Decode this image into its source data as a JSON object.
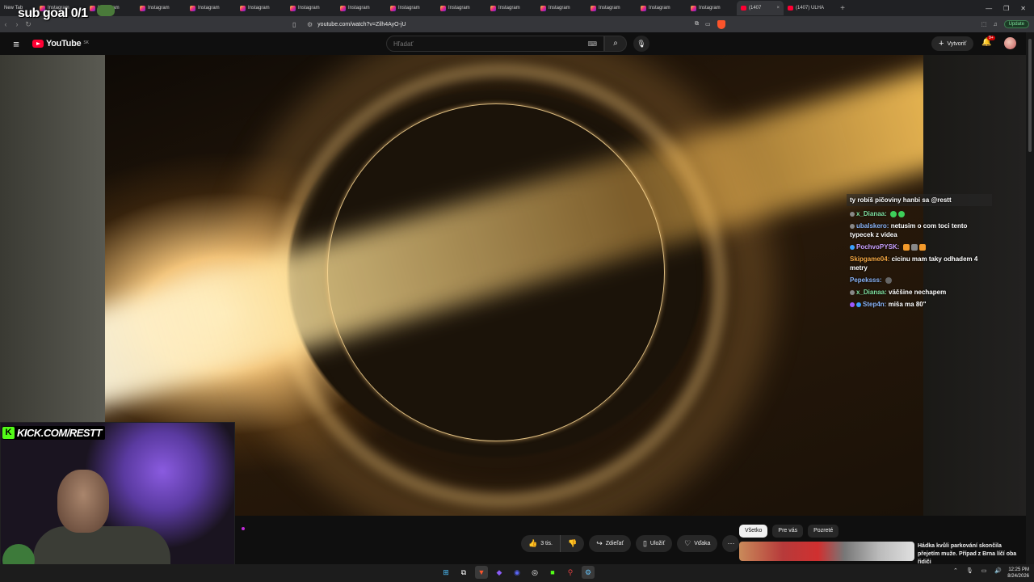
{
  "tabs": {
    "newtab_label": "New Tab",
    "items": [
      "Instagram",
      "Instagram",
      "Instagram",
      "Instagram",
      "Instagram",
      "Instagram",
      "Instagram",
      "Instagram",
      "Instagram",
      "Instagram",
      "Instagram",
      "Instagram",
      "Instagram",
      "Instagram"
    ],
    "active_label": "(1407",
    "next_label": "(1407) ULHA",
    "close": "×",
    "plus": "+"
  },
  "addressbar": {
    "url": "youtube.com/watch?v=Zilh4AyO-jU",
    "update_label": "Update"
  },
  "youtube": {
    "logo_text": "YouTube",
    "country": "SK",
    "search_placeholder": "Hľadať",
    "create_label": "Vytvoriť",
    "notif_badge": "9+"
  },
  "overlay": {
    "sub_goal": "sub goal 0/1",
    "kick_text": "KICK.COM/RESTT",
    "kick_k": "K"
  },
  "chat": [
    {
      "user": "",
      "message": "ty robíš pičoviny hanbi sa @restt",
      "user_color": "#ffffff"
    },
    {
      "user": "x_Dianaa:",
      "message": "",
      "user_color": "#7fe0a0"
    },
    {
      "user": "ubalskero:",
      "message": "netusim o com toci tento typecek z videa",
      "user_color": "#8ab4f8"
    },
    {
      "user": "PochvoPYSK:",
      "message": "",
      "user_color": "#c9a0ff"
    },
    {
      "user": "Skipgame04:",
      "message": "cicinu mam taky odhadem 4 metry",
      "user_color": "#f5a742"
    },
    {
      "user": "Pepeksss:",
      "message": "",
      "user_color": "#8ab4f8"
    },
    {
      "user": "x_Dianaa:",
      "message": "väčšine nechapem",
      "user_color": "#7fe0a0"
    },
    {
      "user": "Step4n:",
      "message": "miša ma 80\"",
      "user_color": "#8ab4f8"
    }
  ],
  "actions": {
    "like_count": "3 tis.",
    "share": "Zdieľať",
    "save": "Uložiť",
    "thanks": "Vďaka",
    "more": "···"
  },
  "chips": [
    "Všetko",
    "Pre vás",
    "Pozreté"
  ],
  "recommendation": {
    "title": "Hádka kvůli parkování skončila přejetím muže. Případ z Brna líčí oba řidiči"
  },
  "taskbar": {
    "time": "12:25 PM",
    "date": "8/24/2026"
  }
}
